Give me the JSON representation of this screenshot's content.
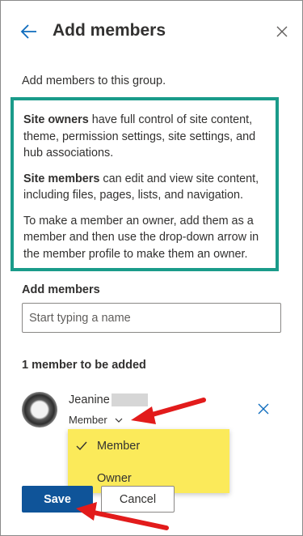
{
  "header": {
    "title": "Add members",
    "back_icon": "arrow-left-icon",
    "close_icon": "close-icon"
  },
  "intro": "Add members to this group.",
  "info": {
    "owners_bold": "Site owners",
    "owners_text": " have full control of site content, theme, permission settings, site settings, and hub associations.",
    "members_bold": "Site members",
    "members_text": " can edit and view site content, including files, pages, lists, and navigation.",
    "tip": "To make a member an owner, add them as a member and then use the drop-down arrow in the member profile to make them an owner."
  },
  "add_members": {
    "label": "Add members",
    "placeholder": "Start typing a name",
    "value": ""
  },
  "pending": {
    "count_label": "1 member to be added",
    "member": {
      "name": "Jeanine",
      "role": "Member"
    }
  },
  "role_menu": {
    "options": [
      "Member",
      "Owner"
    ],
    "selected": "Member"
  },
  "buttons": {
    "save": "Save",
    "cancel": "Cancel"
  },
  "colors": {
    "accent": "#0f5499",
    "highlight_border": "#1a9b8a",
    "dropdown_bg": "#fbea5a",
    "annotation_arrow": "#e21b1b"
  }
}
